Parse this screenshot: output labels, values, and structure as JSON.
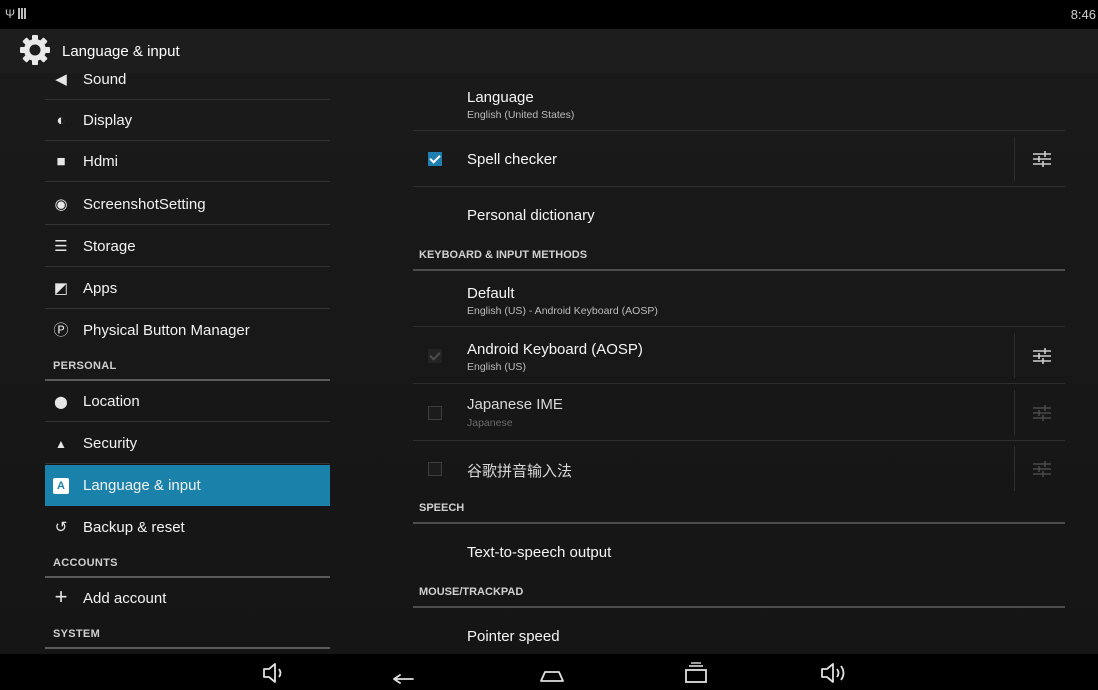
{
  "status_bar": {
    "left_icons": [
      "usb-icon",
      "signal-bars-icon"
    ],
    "usb_glyph": "Ψ",
    "time": "8:46"
  },
  "action_bar": {
    "icon": "settings-gear-icon",
    "title": "Language & input"
  },
  "sidebar": {
    "items": [
      {
        "label": "Sound",
        "icon": "volume-icon",
        "glyph": "◀"
      },
      {
        "label": "Display",
        "icon": "brightness-icon",
        "glyph": "◐"
      },
      {
        "label": "Hdmi",
        "icon": "hdmi-icon",
        "glyph": "■"
      },
      {
        "label": "ScreenshotSetting",
        "icon": "camera-icon",
        "glyph": "◉"
      },
      {
        "label": "Storage",
        "icon": "storage-icon",
        "glyph": "☰"
      },
      {
        "label": "Apps",
        "icon": "apps-icon",
        "glyph": "◩"
      },
      {
        "label": "Physical Button Manager",
        "icon": "p-circle-icon",
        "glyph": "Ⓟ"
      },
      {
        "label": "Location",
        "icon": "location-pin-icon",
        "glyph": "⬤"
      },
      {
        "label": "Security",
        "icon": "lock-icon",
        "glyph": "▲"
      },
      {
        "label": "Language & input",
        "icon": "keyboard-a-icon",
        "glyph": "A",
        "selected": true
      },
      {
        "label": "Backup & reset",
        "icon": "restore-icon",
        "glyph": "↺"
      },
      {
        "label": "Add account",
        "icon": "plus-icon",
        "glyph": "+"
      }
    ],
    "headers": [
      "PERSONAL",
      "ACCOUNTS",
      "SYSTEM"
    ]
  },
  "main": {
    "language": {
      "title": "Language",
      "summary": "English (United States)"
    },
    "spell_checker": {
      "title": "Spell checker",
      "checked": true
    },
    "personal_dictionary": {
      "title": "Personal dictionary"
    },
    "keyboard_header": "KEYBOARD & INPUT METHODS",
    "default": {
      "title": "Default",
      "summary": "English (US) - Android Keyboard (AOSP)"
    },
    "android_keyboard": {
      "title": "Android Keyboard (AOSP)",
      "summary": "English (US)",
      "checked": true,
      "enabled": false
    },
    "japanese_ime": {
      "title": "Japanese IME",
      "summary": "Japanese",
      "checked": false
    },
    "google_pinyin": {
      "title": "谷歌拼音输入法",
      "checked": false
    },
    "speech_header": "SPEECH",
    "tts": {
      "title": "Text-to-speech output"
    },
    "mouse_header": "MOUSE/TRACKPAD",
    "pointer_speed": {
      "title": "Pointer speed"
    }
  },
  "nav_bar": {
    "buttons": [
      "volume-down-icon",
      "back-icon",
      "home-icon",
      "recents-icon",
      "volume-up-icon"
    ]
  },
  "colors": {
    "accent": "#1a81aa",
    "checkbox_on": "#1e7fb0",
    "background": "#151515"
  }
}
